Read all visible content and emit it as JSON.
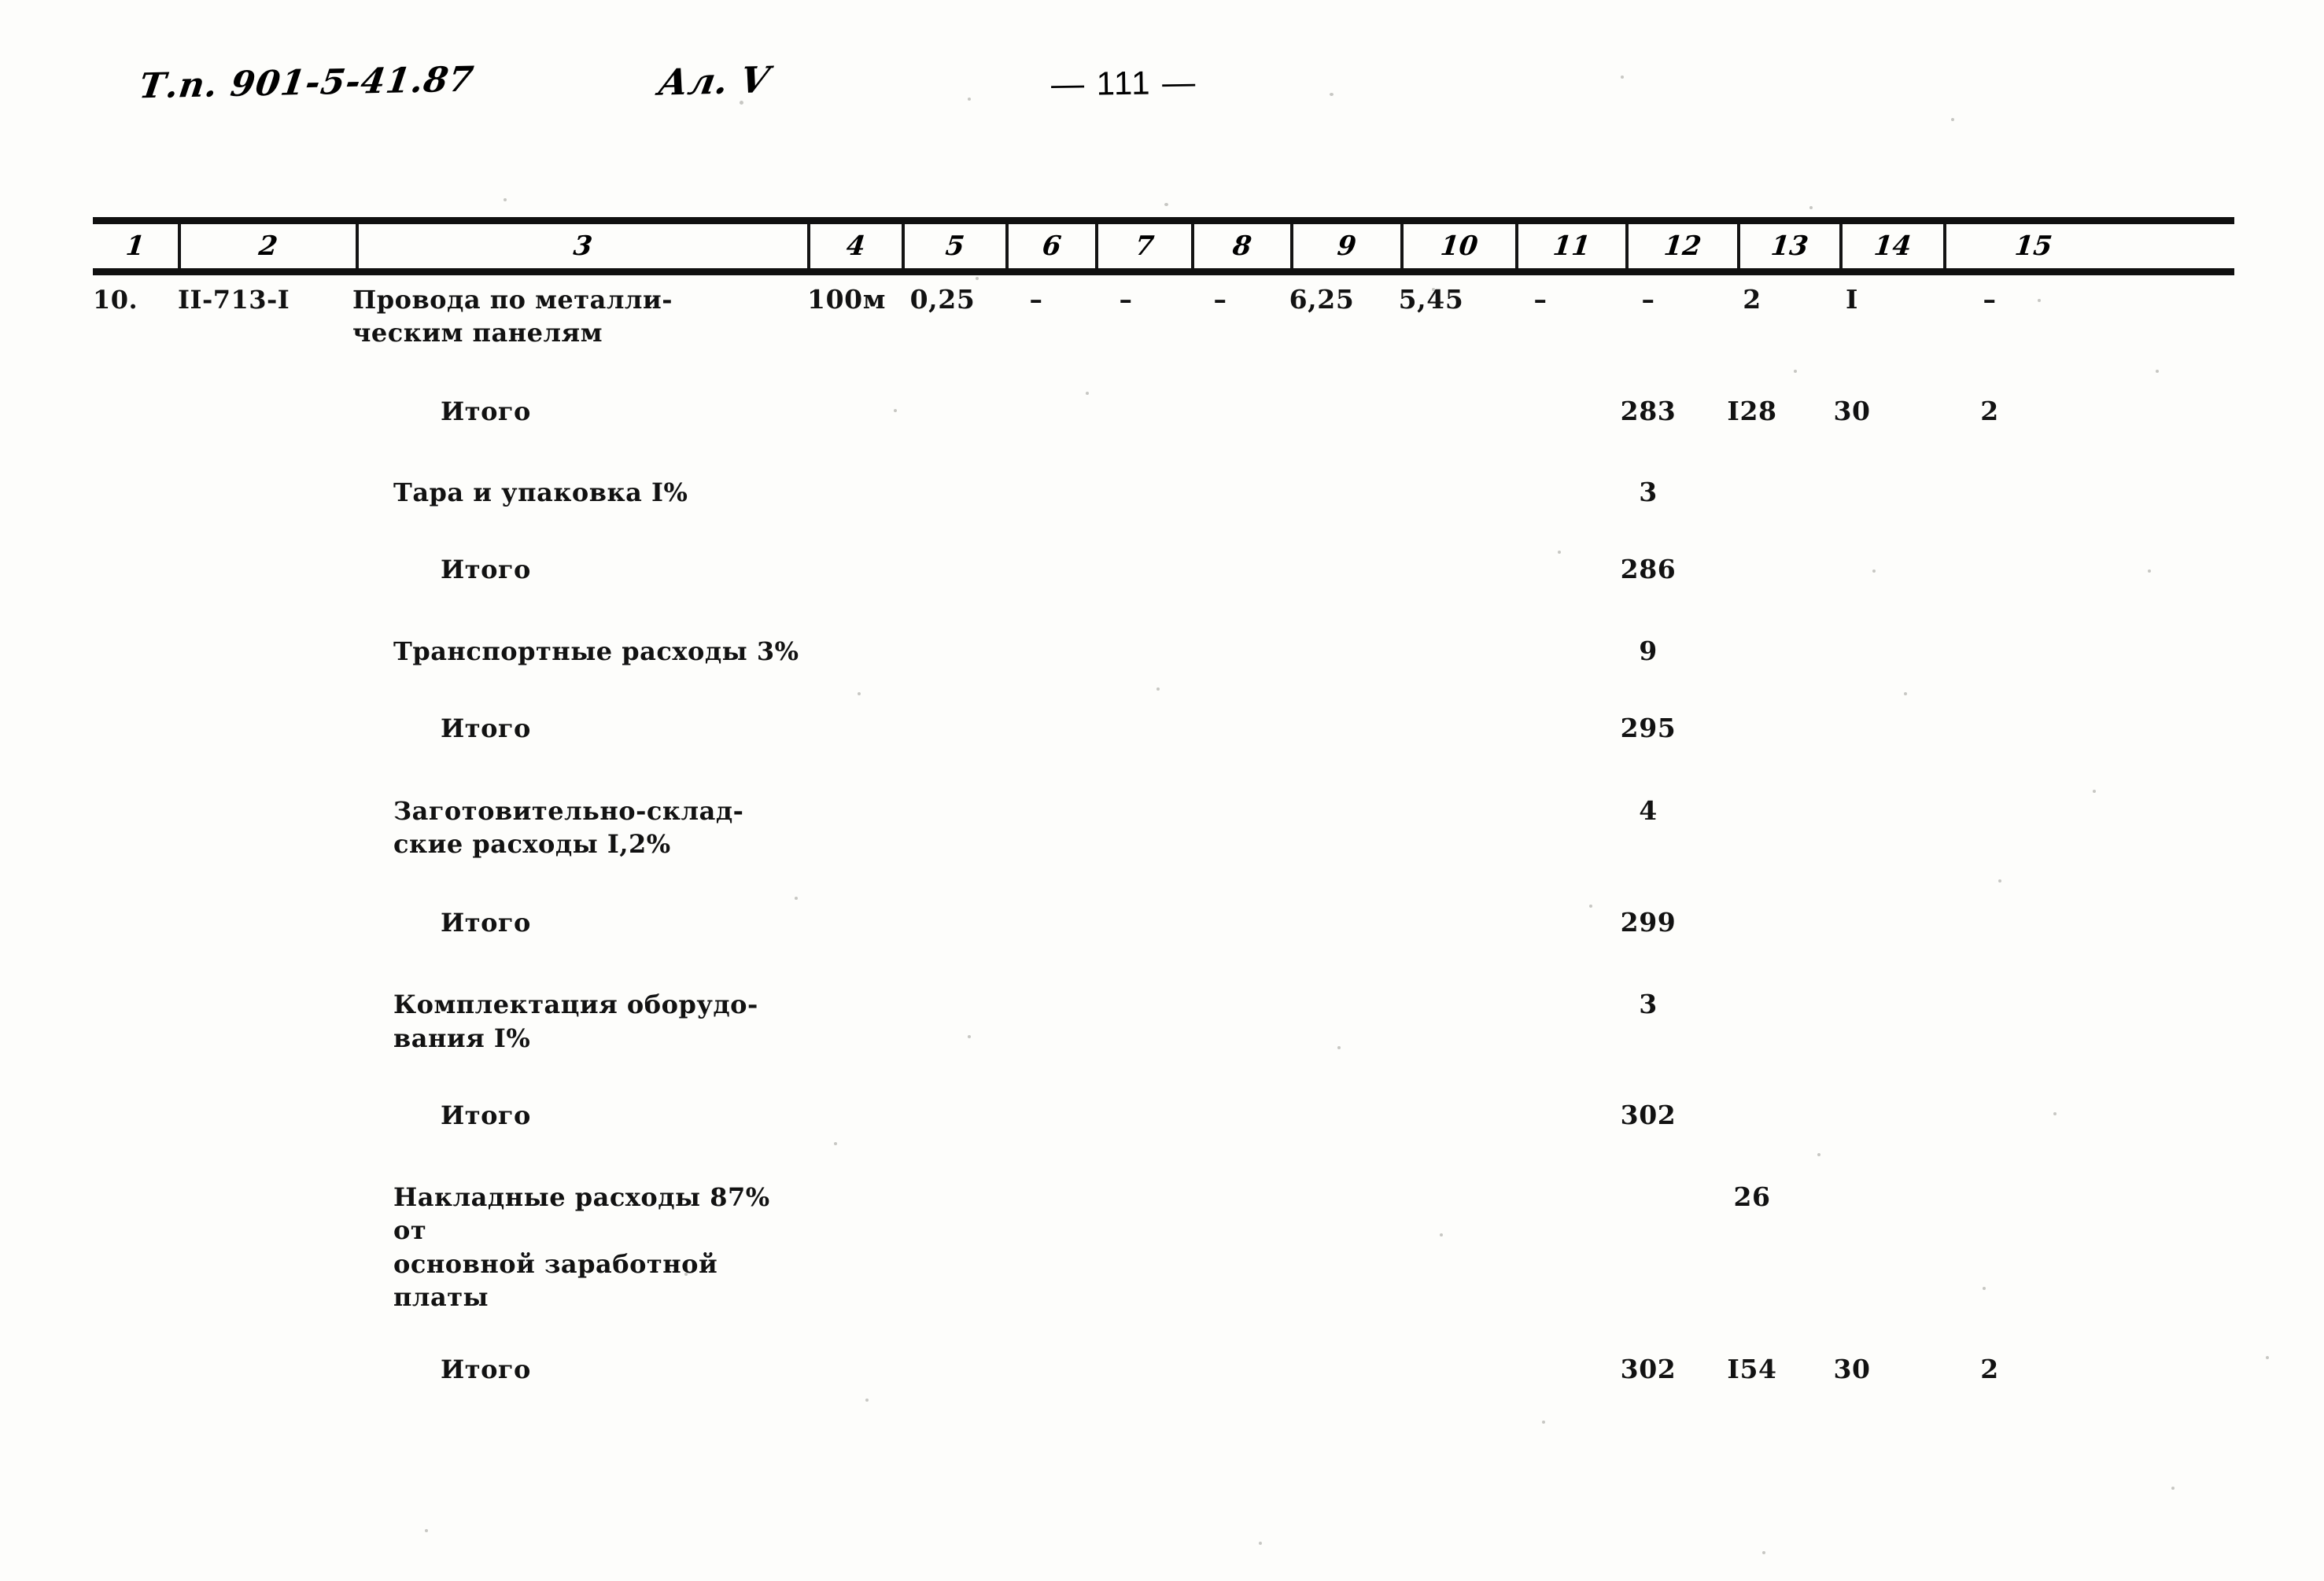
{
  "header": {
    "doc_code": "Т.п. 901-5-41.87",
    "album": "Ал. V",
    "page_number": "— 111 —"
  },
  "table": {
    "column_numbers": [
      "1",
      "2",
      "3",
      "4",
      "5",
      "6",
      "7",
      "8",
      "9",
      "10",
      "11",
      "12",
      "13",
      "14",
      "15"
    ],
    "rows": [
      {
        "kind": "item",
        "c1": "10.",
        "c2": "II-713-I",
        "c3": "Провода по металли-\nческим панелям",
        "c4": "100м",
        "c5": "0,25",
        "c6": "–",
        "c7": "–",
        "c8": "–",
        "c9": "6,25",
        "c10": "5,45",
        "c11": "–",
        "c12": "–",
        "c13": "2",
        "c14": "I",
        "c15": "–"
      },
      {
        "kind": "total",
        "c1": "",
        "c2": "",
        "c3": "Итого",
        "c4": "",
        "c5": "",
        "c6": "",
        "c7": "",
        "c8": "",
        "c9": "",
        "c10": "",
        "c11": "",
        "c12": "283",
        "c13": "I28",
        "c14": "30",
        "c15": "2"
      },
      {
        "kind": "charge",
        "c1": "",
        "c2": "",
        "c3": "Тара и упаковка I%",
        "c4": "",
        "c5": "",
        "c6": "",
        "c7": "",
        "c8": "",
        "c9": "",
        "c10": "",
        "c11": "",
        "c12": "3",
        "c13": "",
        "c14": "",
        "c15": ""
      },
      {
        "kind": "total",
        "c1": "",
        "c2": "",
        "c3": "Итого",
        "c4": "",
        "c5": "",
        "c6": "",
        "c7": "",
        "c8": "",
        "c9": "",
        "c10": "",
        "c11": "",
        "c12": "286",
        "c13": "",
        "c14": "",
        "c15": ""
      },
      {
        "kind": "charge",
        "c1": "",
        "c2": "",
        "c3": "Транспортные расходы 3%",
        "c4": "",
        "c5": "",
        "c6": "",
        "c7": "",
        "c8": "",
        "c9": "",
        "c10": "",
        "c11": "",
        "c12": "9",
        "c13": "",
        "c14": "",
        "c15": ""
      },
      {
        "kind": "total",
        "c1": "",
        "c2": "",
        "c3": "Итого",
        "c4": "",
        "c5": "",
        "c6": "",
        "c7": "",
        "c8": "",
        "c9": "",
        "c10": "",
        "c11": "",
        "c12": "295",
        "c13": "",
        "c14": "",
        "c15": ""
      },
      {
        "kind": "charge",
        "c1": "",
        "c2": "",
        "c3": "Заготовительно-склад-\nские расходы I,2%",
        "c4": "",
        "c5": "",
        "c6": "",
        "c7": "",
        "c8": "",
        "c9": "",
        "c10": "",
        "c11": "",
        "c12": "4",
        "c13": "",
        "c14": "",
        "c15": ""
      },
      {
        "kind": "total",
        "c1": "",
        "c2": "",
        "c3": "Итого",
        "c4": "",
        "c5": "",
        "c6": "",
        "c7": "",
        "c8": "",
        "c9": "",
        "c10": "",
        "c11": "",
        "c12": "299",
        "c13": "",
        "c14": "",
        "c15": ""
      },
      {
        "kind": "charge",
        "c1": "",
        "c2": "",
        "c3": "Комплектация оборудо-\n  вания I%",
        "c4": "",
        "c5": "",
        "c6": "",
        "c7": "",
        "c8": "",
        "c9": "",
        "c10": "",
        "c11": "",
        "c12": "3",
        "c13": "",
        "c14": "",
        "c15": ""
      },
      {
        "kind": "total",
        "c1": "",
        "c2": "",
        "c3": "Итого",
        "c4": "",
        "c5": "",
        "c6": "",
        "c7": "",
        "c8": "",
        "c9": "",
        "c10": "",
        "c11": "",
        "c12": "302",
        "c13": "",
        "c14": "",
        "c15": ""
      },
      {
        "kind": "charge",
        "c1": "",
        "c2": "",
        "c3": "Накладные расходы 87% от\nосновной заработной платы",
        "c4": "",
        "c5": "",
        "c6": "",
        "c7": "",
        "c8": "",
        "c9": "",
        "c10": "",
        "c11": "",
        "c12": "",
        "c13": "26",
        "c14": "",
        "c15": ""
      },
      {
        "kind": "total",
        "c1": "",
        "c2": "",
        "c3": "Итого",
        "c4": "",
        "c5": "",
        "c6": "",
        "c7": "",
        "c8": "",
        "c9": "",
        "c10": "",
        "c11": "",
        "c12": "302",
        "c13": "I54",
        "c14": "30",
        "c15": "2"
      }
    ]
  }
}
